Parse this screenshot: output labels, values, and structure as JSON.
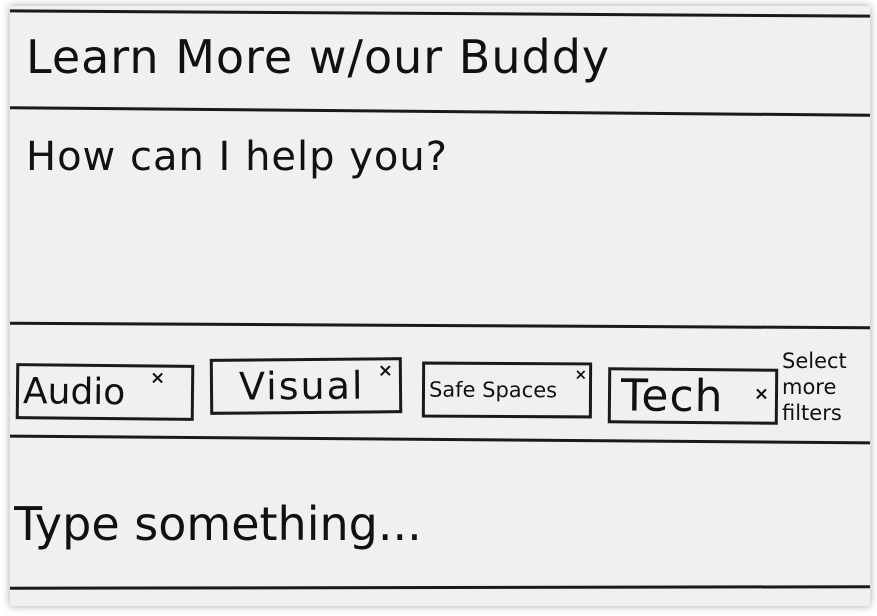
{
  "header": {
    "title": "Learn More w/our Buddy"
  },
  "chat": {
    "prompt": "How can I help you?"
  },
  "filters": {
    "chips": [
      {
        "label": "Audio",
        "remove": "×"
      },
      {
        "label": "Visual",
        "remove": "×"
      },
      {
        "label": "Safe Spaces",
        "remove": "×"
      },
      {
        "label": "Tech",
        "remove": "×"
      }
    ],
    "more_label": "Select more filters"
  },
  "composer": {
    "placeholder": "Type something..."
  }
}
